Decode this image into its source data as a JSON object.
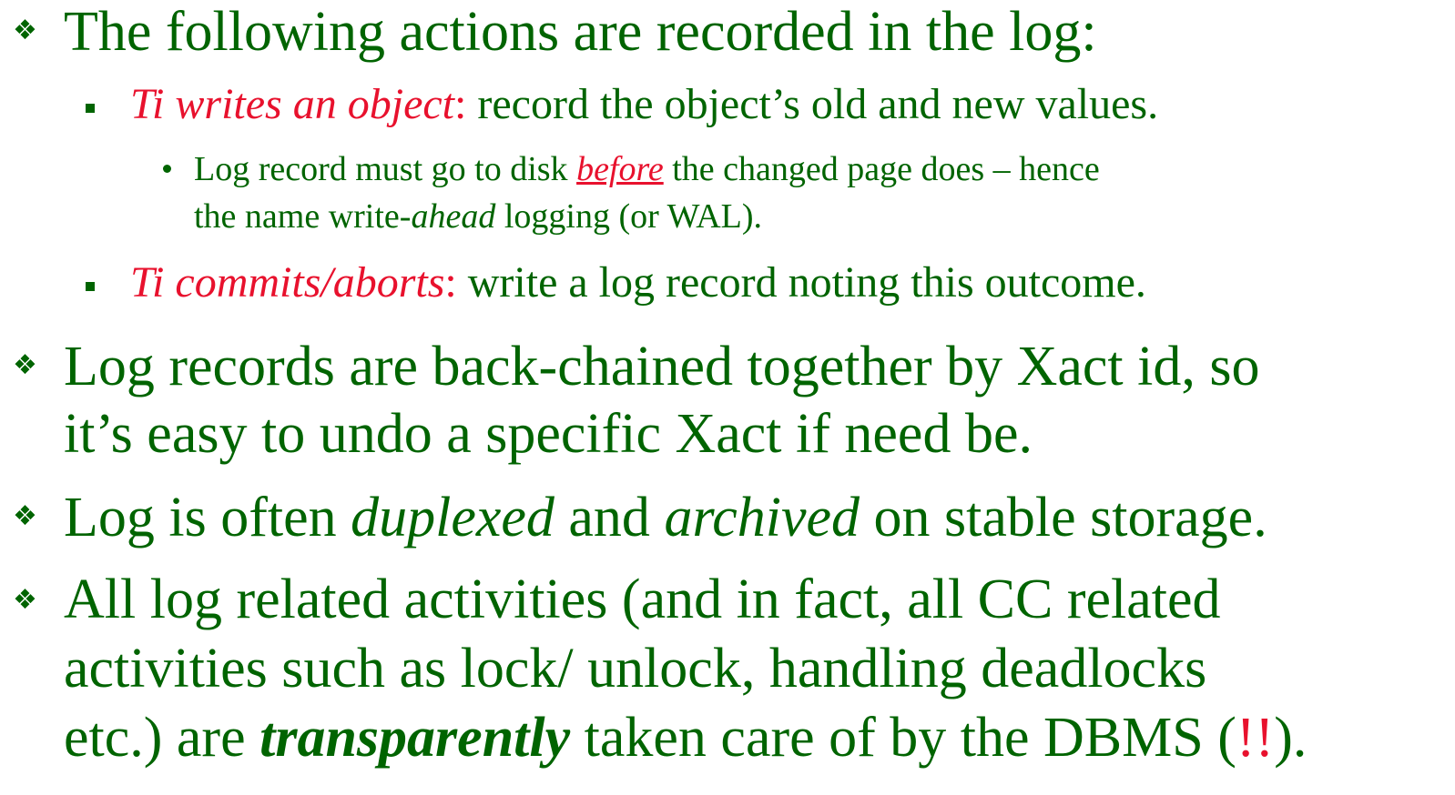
{
  "bullets": [
    {
      "text": "The following actions are recorded in the log:",
      "sub": [
        {
          "lead": "Ti writes an object",
          "sep": ":",
          "text": " record the object’s old and new values.",
          "sub": [
            {
              "t1": "Log record must go to disk ",
              "emph": "before",
              "t2": " the changed page does – hence",
              "t3": "the name write-",
              "emph2": "ahead",
              "t4": " logging (or WAL)."
            }
          ]
        },
        {
          "lead": "Ti commits/aborts",
          "sep": ":",
          "text": "  write a log record noting this outcome."
        }
      ]
    },
    {
      "line1": "Log records are back-chained together by Xact id, so",
      "line2": "it’s easy to undo a specific Xact if need be."
    },
    {
      "t1": "Log is often ",
      "emph1": "duplexed",
      "t2": " and ",
      "emph2": "archived",
      "t3": " on stable storage."
    },
    {
      "line1": "All log related activities (and in fact, all CC related",
      "line2": "activities such as lock/ unlock, handling deadlocks",
      "line3a": "etc.) are ",
      "line3emph": "transparently",
      "line3b": " taken care of by the DBMS (",
      "line3red": "!!",
      "line3c": ")."
    }
  ]
}
